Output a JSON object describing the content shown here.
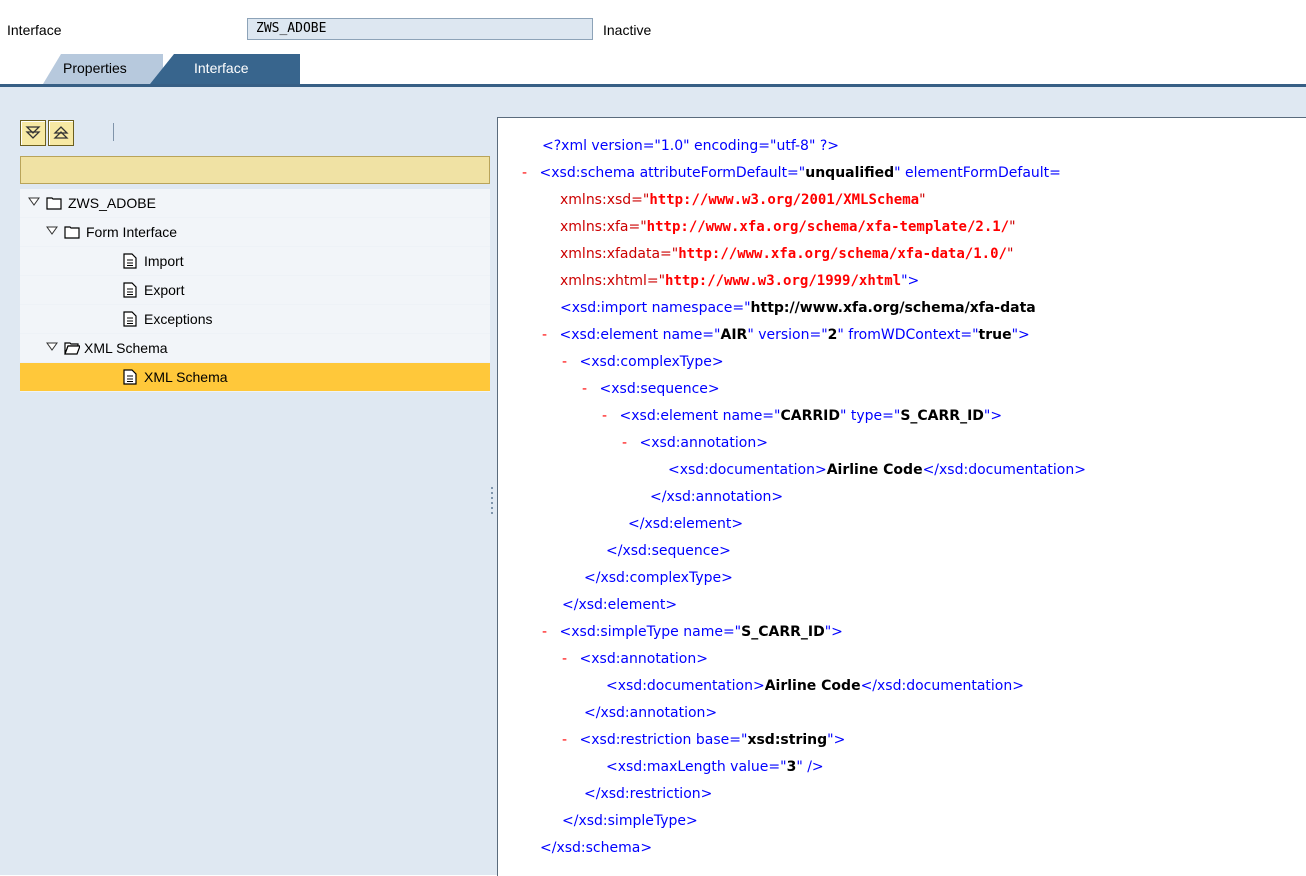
{
  "header": {
    "label": "Interface",
    "name_value": "ZWS_ADOBE",
    "status": "Inactive"
  },
  "tabs": [
    {
      "label": "Properties",
      "active": false
    },
    {
      "label": "Interface",
      "active": true
    }
  ],
  "toolbar": {
    "expand_icon": "expand-all-icon",
    "collapse_icon": "collapse-all-icon"
  },
  "tree": {
    "root": "ZWS_ADOBE",
    "form_interface": "Form Interface",
    "items": [
      "Import",
      "Export",
      "Exceptions"
    ],
    "schema_folder": "XML Schema",
    "schema_item": "XML Schema"
  },
  "xml": {
    "decl": "<?xml version=\"1.0\" encoding=\"utf-8\" ?>",
    "schema_open": "<xsd:schema attributeFormDefault=\"",
    "schema_attr_val": "unqualified",
    "schema_open_tail": "\" elementFormDefault=",
    "ns_xsd_key": "xmlns:xsd=\"",
    "ns_xsd_val": "http://www.w3.org/2001/XMLSchema",
    "ns_xfa_key": "xmlns:xfa=\"",
    "ns_xfa_val": "http://www.xfa.org/schema/xfa-template/2.1/",
    "ns_xfadata_key": "xmlns:xfadata=\"",
    "ns_xfadata_val": "http://www.xfa.org/schema/xfa-data/1.0/",
    "ns_xhtml_key": "xmlns:xhtml=\"",
    "ns_xhtml_val": "http://www.w3.org/1999/xhtml",
    "close_quote_gt": "\">",
    "import_open": "<xsd:import namespace=\"",
    "import_val": "http://www.xfa.org/schema/xfa-data",
    "element_air_open": "<xsd:element name=\"",
    "element_air_name": "AIR",
    "element_air_mid": "\" version=\"",
    "element_air_ver": "2",
    "element_air_mid2": "\" fromWDContext=\"",
    "element_air_ctx": "true",
    "complexType_open": "<xsd:complexType>",
    "sequence_open": "<xsd:sequence>",
    "element_carrid_open": "<xsd:element name=\"",
    "element_carrid_name": "CARRID",
    "element_carrid_mid": "\" type=\"",
    "element_carrid_type": "S_CARR_ID",
    "annotation_open": "<xsd:annotation>",
    "doc_open": "<xsd:documentation>",
    "doc_text": "Airline Code",
    "doc_close": "</xsd:documentation>",
    "annotation_close": "</xsd:annotation>",
    "element_close": "</xsd:element>",
    "sequence_close": "</xsd:sequence>",
    "complexType_close": "</xsd:complexType>",
    "simpleType_open": "<xsd:simpleType name=\"",
    "simpleType_name": "S_CARR_ID",
    "restriction_open": "<xsd:restriction base=\"",
    "restriction_base": "xsd:string",
    "maxlength_open": "<xsd:maxLength value=\"",
    "maxlength_val": "3",
    "maxlength_close": "\" />",
    "restriction_close": "</xsd:restriction>",
    "simpleType_close": "</xsd:simpleType>",
    "schema_close": "</xsd:schema>",
    "gt": "\">",
    "dash": "-"
  },
  "colors": {
    "tab_active": "#38658d",
    "tab_inactive": "#b7c9dd",
    "selected_row": "#ffc83a",
    "panel_bg": "#dfe8f2",
    "xml_tag": "#0000ff",
    "xml_namespace": "#ff0000"
  }
}
